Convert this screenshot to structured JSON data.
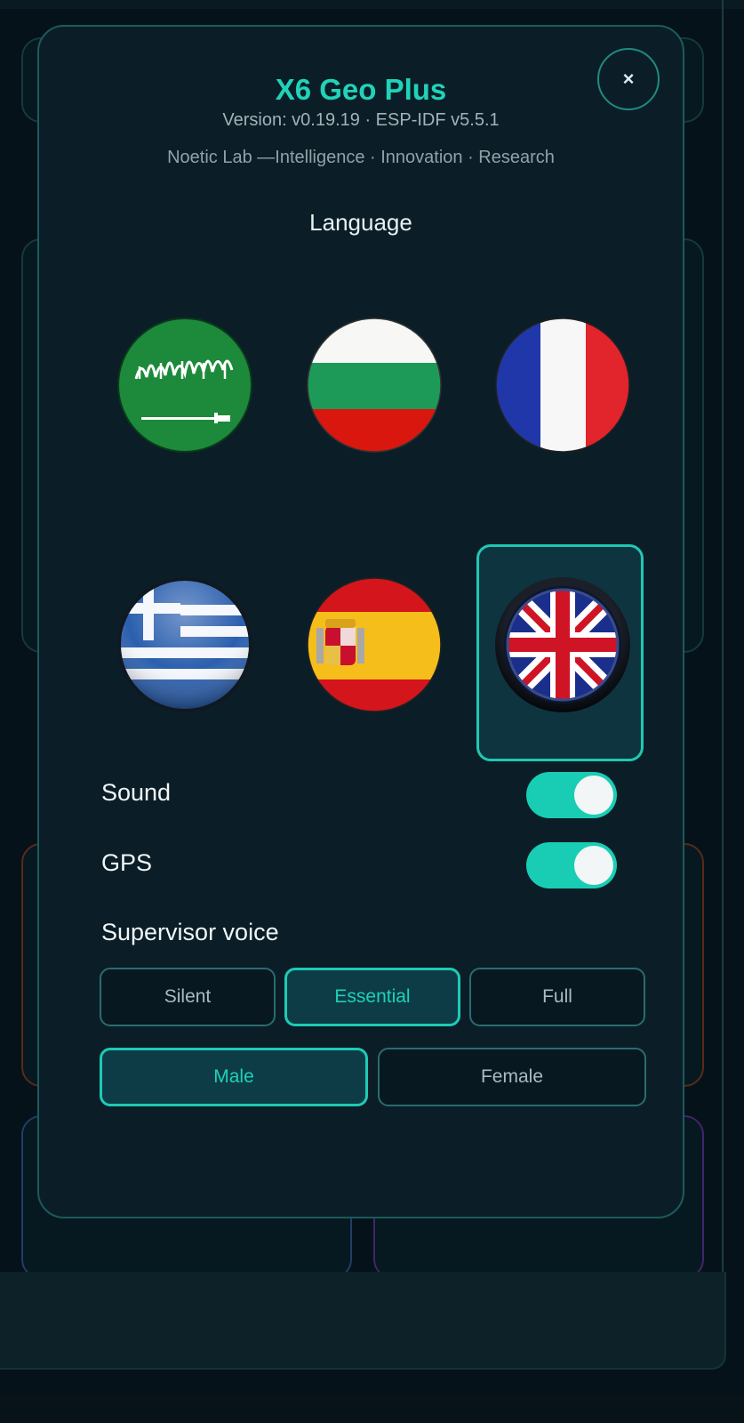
{
  "app": {
    "title": "X6 Geo Plus",
    "version_line": "Version: v0.19.19  ·  ESP-IDF v5.5.1",
    "tagline": "Noetic Lab —Intelligence · Innovation · Research",
    "close_label": "×"
  },
  "language": {
    "heading": "Language",
    "flags": [
      {
        "country": "Saudi Arabia",
        "icon": "saudi-arabia-flag-icon"
      },
      {
        "country": "Bulgaria",
        "icon": "bulgaria-flag-icon"
      },
      {
        "country": "France",
        "icon": "france-flag-icon"
      },
      {
        "country": "Greece",
        "icon": "greece-flag-icon"
      },
      {
        "country": "Spain",
        "icon": "spain-flag-icon"
      },
      {
        "country": "United Kingdom",
        "icon": "uk-flag-icon",
        "selected": true
      }
    ]
  },
  "settings": {
    "sound": {
      "label": "Sound",
      "on": true
    },
    "gps": {
      "label": "GPS",
      "on": true
    }
  },
  "supervisor_voice": {
    "label": "Supervisor voice",
    "levels": [
      {
        "label": "Silent",
        "active": false
      },
      {
        "label": "Essential",
        "active": true
      },
      {
        "label": "Full",
        "active": false
      }
    ],
    "genders": [
      {
        "label": "Male",
        "active": true
      },
      {
        "label": "Female",
        "active": false
      }
    ]
  },
  "colors": {
    "accent": "#1fd1b7",
    "background": "#05121a",
    "panel": "#0b1e27"
  }
}
